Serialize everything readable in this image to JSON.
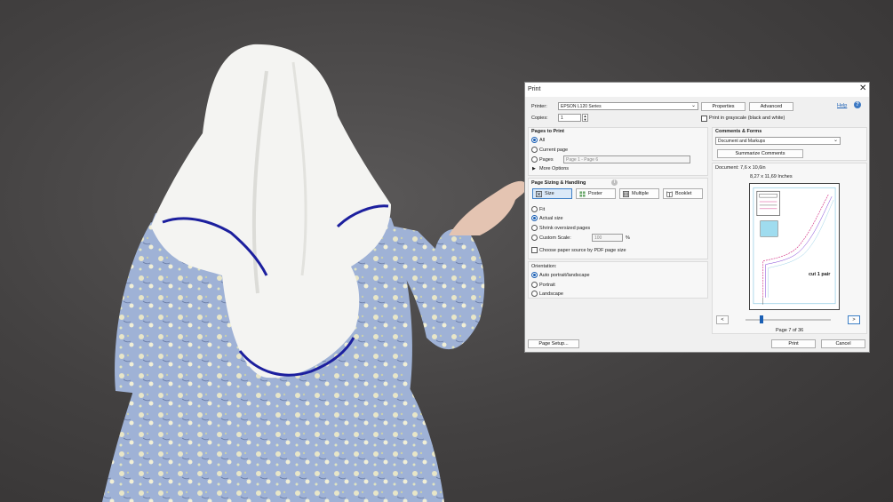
{
  "dialog": {
    "title": "Print",
    "help": "Help",
    "printer_label": "Printer:",
    "printer_value": "EPSON L120 Series",
    "properties": "Properties",
    "advanced": "Advanced",
    "copies_label": "Copies:",
    "copies_value": "1",
    "grayscale": "Print in grayscale (black and white)",
    "pages_to_print": {
      "heading": "Pages to Print",
      "all": "All",
      "current": "Current page",
      "pages": "Pages",
      "pages_value": "Page 1 - Page 6",
      "more": "More Options"
    },
    "sizing": {
      "heading": "Page Sizing & Handling",
      "size": "Size",
      "poster": "Poster",
      "multiple": "Multiple",
      "booklet": "Booklet",
      "fit": "Fit",
      "actual": "Actual size",
      "shrink": "Shrink oversized pages",
      "custom": "Custom Scale:",
      "custom_value": "100",
      "percent": "%",
      "paper_source": "Choose paper source by PDF page size"
    },
    "orientation": {
      "heading": "Orientation:",
      "auto": "Auto portrait/landscape",
      "portrait": "Portrait",
      "landscape": "Landscape"
    },
    "comments": {
      "heading": "Comments & Forms",
      "value": "Document and Markups",
      "summarize": "Summarize Comments"
    },
    "document_size": "Document: 7,6 x 10,6in",
    "paper_size": "8,27 x 11,69 Inches",
    "preview_text": "cut 1 pair",
    "prev": "<",
    "next": ">",
    "page_indicator": "Page 7 of 36",
    "page_setup": "Page Setup...",
    "print": "Print",
    "cancel": "Cancel"
  },
  "colors": {
    "accent": "#1a5fb4",
    "dress": "#9fb2d6",
    "veil": "#f4f4f2",
    "trim": "#1c1f9e",
    "background": "#454343"
  },
  "icons": {
    "close": "close-icon",
    "help": "help-icon",
    "info": "info-icon"
  }
}
